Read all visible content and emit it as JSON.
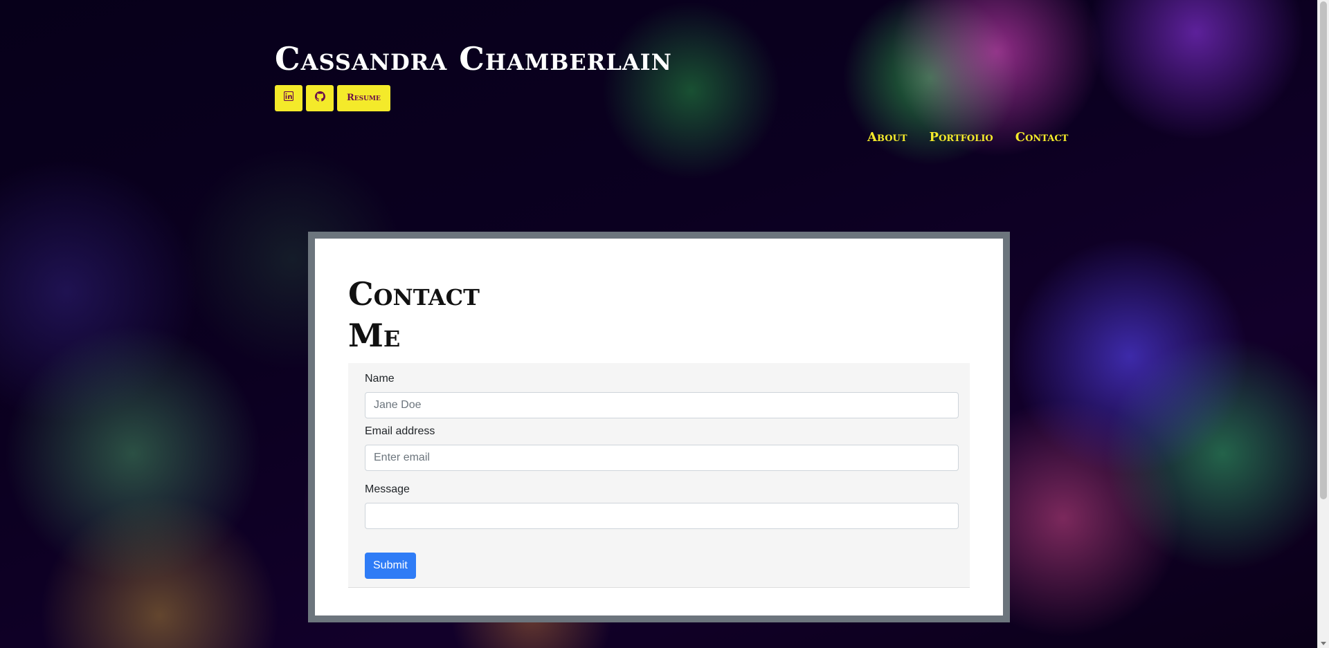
{
  "header": {
    "title": "Cassandra Chamberlain",
    "social": [
      {
        "label": "",
        "icon": "linkedin-icon"
      },
      {
        "label": "",
        "icon": "github-icon"
      }
    ],
    "resume_label": "Resume"
  },
  "nav": {
    "items": [
      "About",
      "Portfolio",
      "Contact"
    ]
  },
  "contact": {
    "title": "Contact Me",
    "fields": {
      "name_label": "Name",
      "name_placeholder": "Jane Doe",
      "email_label": "Email address",
      "email_placeholder": "Enter email",
      "message_label": "Message",
      "message_value": ""
    },
    "submit_label": "Submit"
  },
  "colors": {
    "accent_yellow": "#f4ea2a",
    "button_blue": "#2f7cf6",
    "card_frame": "#6c757d"
  }
}
